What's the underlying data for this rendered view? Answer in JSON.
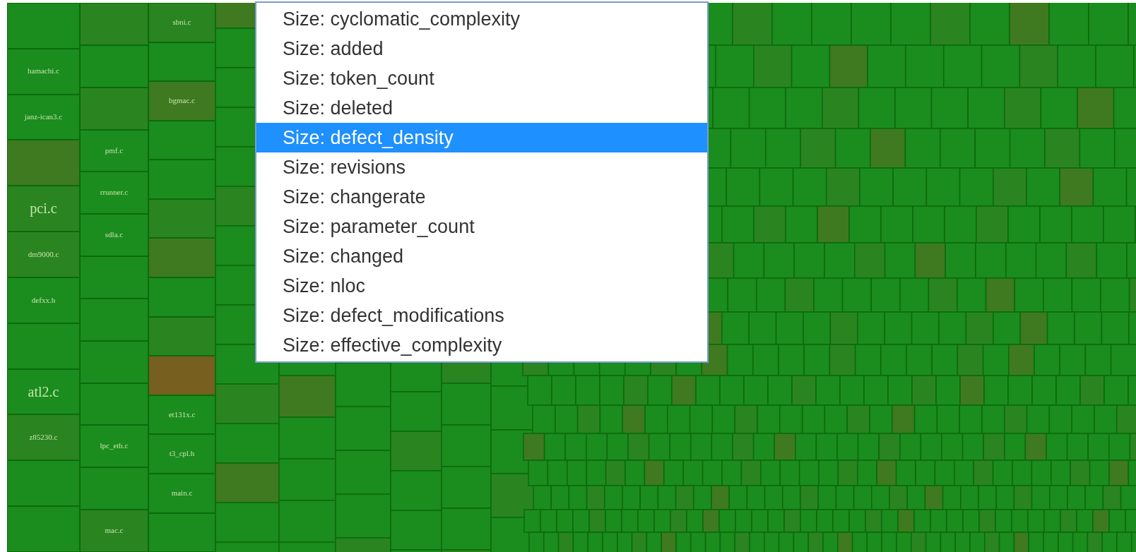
{
  "treemap": {
    "columns": [
      {
        "tiles": [
          {
            "color": "#1b8c1e"
          },
          {
            "label": "hamachi.c",
            "color": "#1b8c1e"
          },
          {
            "label": "janz-ican3.c",
            "color": "#1b8c1e"
          },
          {
            "color": "#3f7a20"
          },
          {
            "label": "pci.c",
            "large": true,
            "color": "#2a8420"
          },
          {
            "label": "dm9000.c",
            "color": "#2a8420"
          },
          {
            "label": "defxx.h",
            "color": "#1b8c1e"
          },
          {
            "color": "#1b8c1e"
          },
          {
            "label": "atl2.c",
            "large": true,
            "color": "#1b8c1e"
          },
          {
            "label": "z85230.c",
            "color": "#2a8420"
          },
          {
            "color": "#1b8c1e"
          },
          {
            "color": "#1b8c1e"
          }
        ]
      },
      {
        "tiles": [
          {
            "color": "#2a8420"
          },
          {
            "color": "#1b8c1e"
          },
          {
            "color": "#2a8420"
          },
          {
            "label": "pmf.c",
            "color": "#1b8c1e"
          },
          {
            "label": "rrunner.c",
            "color": "#1b8c1e"
          },
          {
            "label": "sdla.c",
            "color": "#1b8c1e"
          },
          {
            "color": "#1b8c1e"
          },
          {
            "color": "#1b8c1e"
          },
          {
            "color": "#1b8c1e"
          },
          {
            "color": "#1b8c1e"
          },
          {
            "label": "lpc_eth.c",
            "color": "#1b8c1e"
          },
          {
            "color": "#1b8c1e"
          },
          {
            "label": "mac.c",
            "color": "#2a8420"
          }
        ]
      },
      {
        "tiles": [
          {
            "label": "sbni.c",
            "color": "#2a8420"
          },
          {
            "color": "#1b8c1e"
          },
          {
            "label": "bgmac.c",
            "color": "#3f7a20"
          },
          {
            "color": "#1b8c1e"
          },
          {
            "color": "#1b8c1e"
          },
          {
            "color": "#2a8420"
          },
          {
            "color": "#3f7a20"
          },
          {
            "color": "#1b8c1e"
          },
          {
            "color": "#2a8420"
          },
          {
            "color": "#765f1f"
          },
          {
            "label": "et131x.c",
            "color": "#1b8c1e"
          },
          {
            "label": "t3_cpl.h",
            "color": "#1b8c1e"
          },
          {
            "label": "main.c",
            "color": "#1b8c1e"
          },
          {
            "color": "#1b8c1e"
          }
        ]
      }
    ]
  },
  "size_menu": {
    "options": [
      {
        "label": "Size: cyclomatic_complexity",
        "selected": false
      },
      {
        "label": "Size: added",
        "selected": false
      },
      {
        "label": "Size: token_count",
        "selected": false
      },
      {
        "label": "Size: deleted",
        "selected": false
      },
      {
        "label": "Size: defect_density",
        "selected": true
      },
      {
        "label": "Size: revisions",
        "selected": false
      },
      {
        "label": "Size: changerate",
        "selected": false
      },
      {
        "label": "Size: parameter_count",
        "selected": false
      },
      {
        "label": "Size: changed",
        "selected": false
      },
      {
        "label": "Size: nloc",
        "selected": false
      },
      {
        "label": "Size: defect_modifications",
        "selected": false
      },
      {
        "label": "Size: effective_complexity",
        "selected": false
      }
    ]
  }
}
